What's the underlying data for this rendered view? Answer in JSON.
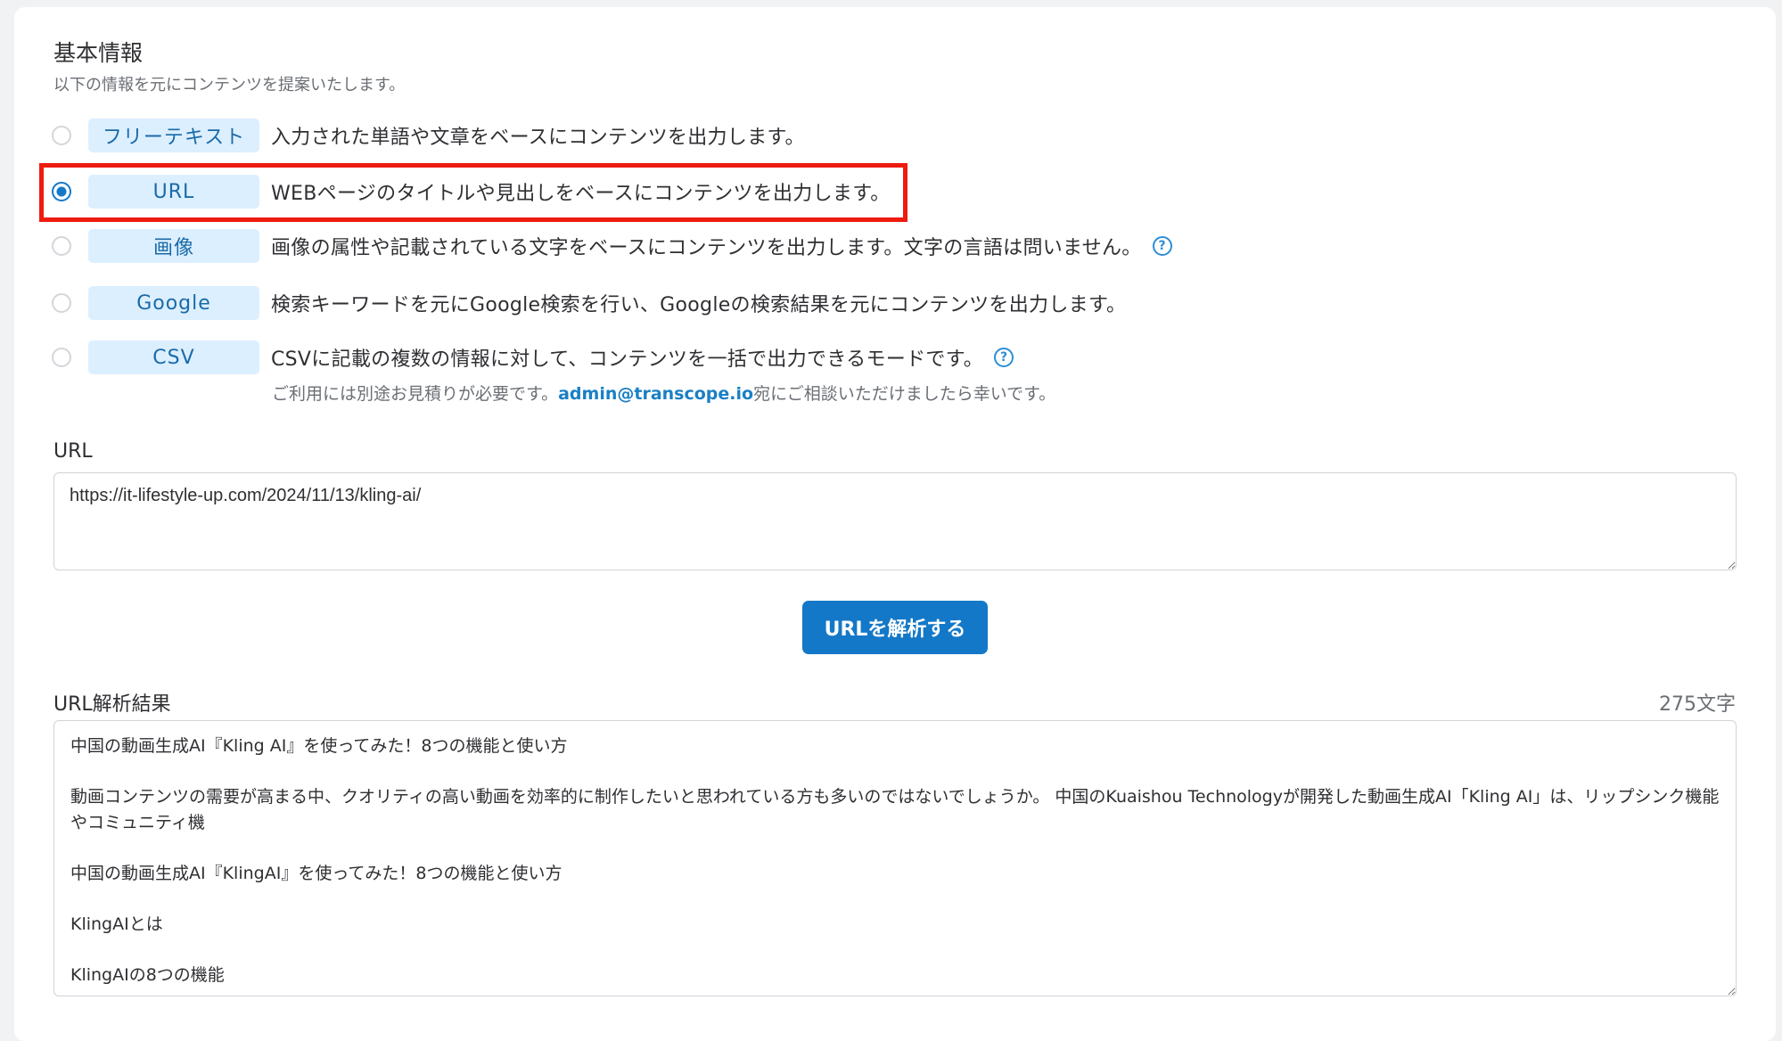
{
  "section": {
    "title": "基本情報",
    "subtitle": "以下の情報を元にコンテンツを提案いたします。"
  },
  "options": [
    {
      "tag": "フリーテキスト",
      "description": "入力された単語や文章をベースにコンテンツを出力します。",
      "selected": false
    },
    {
      "tag": "URL",
      "description": "WEBページのタイトルや見出しをベースにコンテンツを出力します。",
      "selected": true
    },
    {
      "tag": "画像",
      "description": "画像の属性や記載されている文字をベースにコンテンツを出力します。文字の言語は問いません。",
      "selected": false,
      "help": "?"
    },
    {
      "tag": "Google",
      "description": "検索キーワードを元にGoogle検索を行い、Googleの検索結果を元にコンテンツを出力します。",
      "selected": false
    },
    {
      "tag": "CSV",
      "description": "CSVに記載の複数の情報に対して、コンテンツを一括で出力できるモードです。",
      "selected": false,
      "help": "?"
    }
  ],
  "csv_note": {
    "before": "ご利用には別途お見積りが必要です。",
    "email": "admin@transcope.io",
    "after": "宛にご相談いただけましたら幸いです。"
  },
  "url_field": {
    "label": "URL",
    "value": "https://it-lifestyle-up.com/2024/11/13/kling-ai/"
  },
  "analyze_button": {
    "label": "URLを解析する"
  },
  "result": {
    "label": "URL解析結果",
    "char_count": "275文字",
    "text": "中国の動画生成AI『Kling AI』を使ってみた！8つの機能と使い方\n\n動画コンテンツの需要が高まる中、クオリティの高い動画を効率的に制作したいと思われている方も多いのではないでしょうか。 中国のKuaishou Technologyが開発した動画生成AI「Kling AI」は、リップシンク機能やコミュニティ機\n\n中国の動画生成AI『KlingAI』を使ってみた！8つの機能と使い方\n\nKlingAIとは\n\nKlingAIの8つの機能"
  },
  "colors": {
    "accent": "#1478c8",
    "tag_bg": "#dcefff",
    "highlight": "#ee1b0f"
  }
}
